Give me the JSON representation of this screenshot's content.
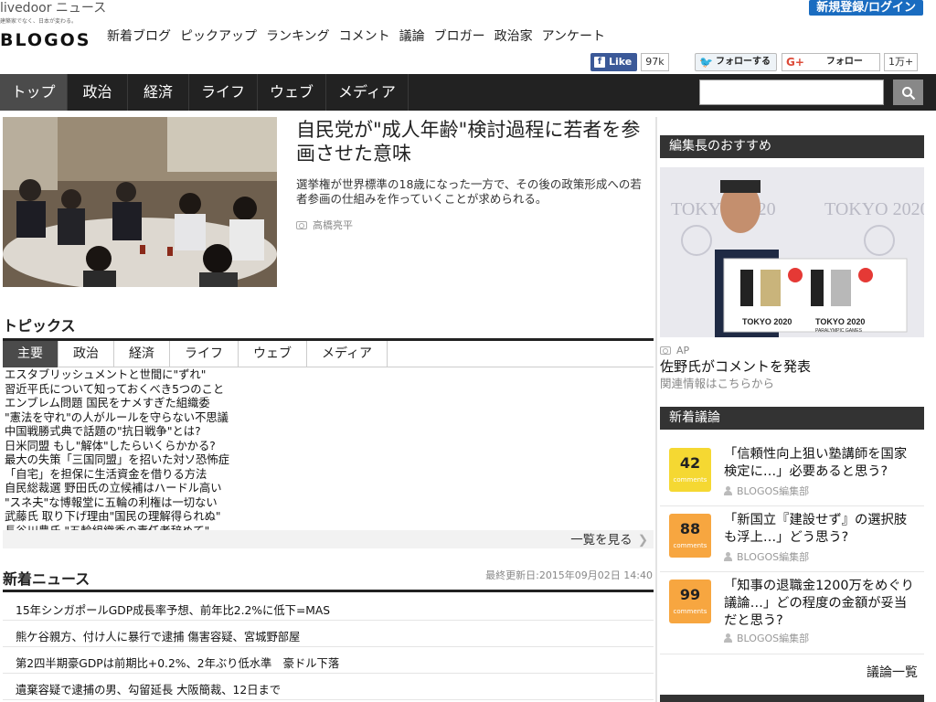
{
  "header": {
    "livedoor": "livedoor ニュース",
    "tagline": "建築家でなく、日本が変わる。",
    "logo": "BLOGOS",
    "signup": "新規登録/ログイン",
    "topnav": [
      "新着ブログ",
      "ピックアップ",
      "ランキング",
      "コメント",
      "議論",
      "ブロガー",
      "政治家",
      "アンケート"
    ]
  },
  "social": {
    "facebook_label": "Like",
    "facebook_count": "97k",
    "twitter_label": "フォローする",
    "google_label": "フォロー",
    "google_count": "1万+"
  },
  "mainnav": {
    "items": [
      "トップ",
      "政治",
      "経済",
      "ライフ",
      "ウェブ",
      "メディア"
    ],
    "active": "トップ"
  },
  "feature": {
    "title": "自民党が\"成人年齢\"検討過程に若者を参画させた意味",
    "description": "選挙権が世界標準の18歳になった一方で、その後の政策形成への若者参画の仕組みを作っていくことが求められる。",
    "author": "高橋亮平"
  },
  "topics": {
    "title": "トピックス",
    "tabs": [
      "主要",
      "政治",
      "経済",
      "ライフ",
      "ウェブ",
      "メディア"
    ],
    "items": [
      "エスタブリッシュメントと世間に\"ずれ\"",
      "習近平氏について知っておくべき5つのこと",
      "エンブレム問題 国民をナメすぎた組織委",
      "\"憲法を守れ\"の人がルールを守らない不思議",
      "中国戦勝式典で話題の\"抗日戦争\"とは?",
      "日米同盟 もし\"解体\"したらいくらかかる?",
      "最大の失策「三国同盟」を招いた対ソ恐怖症",
      "「自宅」を担保に生活資金を借りる方法",
      "自民総裁選 野田氏の立候補はハードル高い",
      "\"スネ夫\"な博報堂に五輪の利権は一切ない",
      "武藤氏 取り下げ理由\"国民の理解得られぬ\"",
      "長谷川豊氏 \"五輪組織委の責任者辞めて\""
    ],
    "more": "一覧を見る"
  },
  "news": {
    "title": "新着ニュース",
    "updated": "最終更新日:2015年09月02日 14:40",
    "items": [
      "15年シンガポールGDP成長率予想、前年比2.2%に低下=MAS",
      "熊ケ谷親方、付け人に暴行で逮捕 傷害容疑、宮城野部屋",
      "第2四半期豪GDPは前期比+0.2%、2年ぶり低水準　豪ドル下落",
      "遺棄容疑で逮捕の男、勾留延長 大阪簡裁、12日まで"
    ]
  },
  "editor_pick": {
    "heading": "編集長のおすすめ",
    "credit": "AP",
    "title": "佐野氏がコメントを発表",
    "sub": "関連情報はこちらから",
    "photo_text": [
      "TOKYO 2020",
      "TOKYO 2020",
      "PARALYMPIC GAMES"
    ]
  },
  "discussions": {
    "heading": "新着議論",
    "comments_label": "comments",
    "items": [
      {
        "count": "42",
        "color": "#f5d832",
        "question": "「信頼性向上狙い塾講師を国家検定に…」必要あると思う?",
        "author": "BLOGOS編集部"
      },
      {
        "count": "88",
        "color": "#f7a640",
        "question": "「新国立『建設せず』の選択肢も浮上…」どう思う?",
        "author": "BLOGOS編集部"
      },
      {
        "count": "99",
        "color": "#f7a640",
        "question": "「知事の退職金1200万をめぐり議論…」どの程度の金額が妥当だと思う?",
        "author": "BLOGOS編集部"
      }
    ],
    "all": "議論一覧"
  }
}
